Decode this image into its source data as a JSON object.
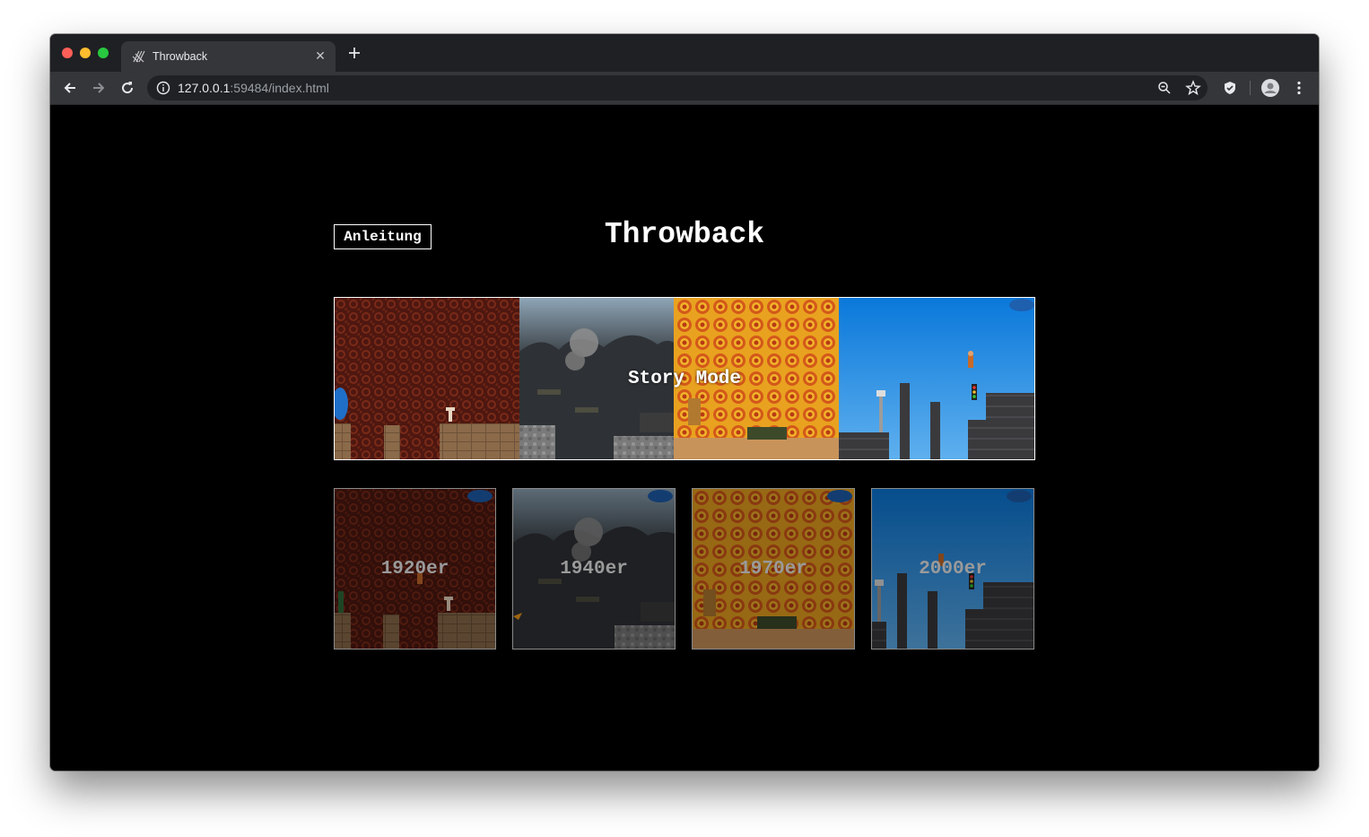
{
  "browser": {
    "tab_title": "Throwback",
    "url_host": "127.0.0.1",
    "url_rest": ":59484/index.html"
  },
  "page": {
    "instructions_label": "Anleitung",
    "title": "Throwback",
    "story_mode_label": "Story Mode",
    "levels": [
      {
        "label": "1920er"
      },
      {
        "label": "1940er"
      },
      {
        "label": "1970er"
      },
      {
        "label": "2000er"
      }
    ]
  },
  "colors": {
    "background": "#000000",
    "text": "#ffffff",
    "era_1920_bg": "#5a1a12",
    "era_1940_bg": "#2c2f33",
    "era_1970_bg": "#e39a1c",
    "era_2000_bg": "#1c7fd6"
  }
}
